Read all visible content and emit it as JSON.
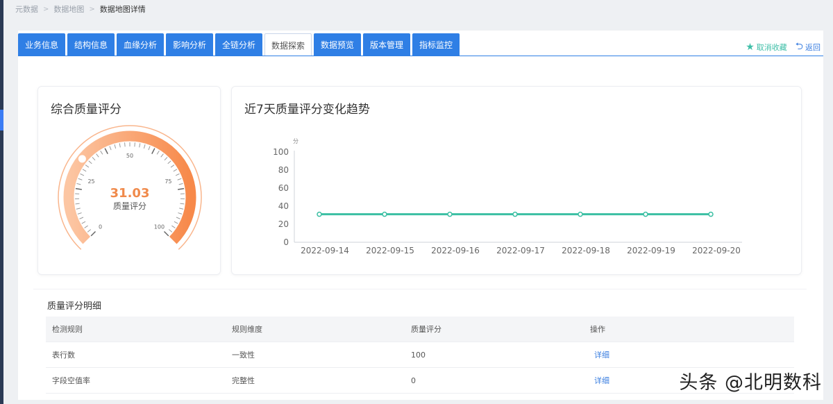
{
  "breadcrumb": [
    "元数据",
    "数据地图",
    "数据地图详情"
  ],
  "tabs": [
    {
      "label": "业务信息",
      "active": false
    },
    {
      "label": "结构信息",
      "active": false
    },
    {
      "label": "血缘分析",
      "active": false
    },
    {
      "label": "影响分析",
      "active": false
    },
    {
      "label": "全链分析",
      "active": false
    },
    {
      "label": "数据探索",
      "active": true
    },
    {
      "label": "数据预览",
      "active": false
    },
    {
      "label": "版本管理",
      "active": false
    },
    {
      "label": "指标监控",
      "active": false
    }
  ],
  "actions": {
    "favorite": "取消收藏",
    "back": "返回",
    "favorite_icon": "star-icon",
    "back_icon": "return-arrow-icon"
  },
  "score": {
    "title": "综合质量评分",
    "value": 31.03,
    "value_text": "31.03",
    "label": "质量评分",
    "ticks": [
      "0",
      "25",
      "50",
      "75",
      "100"
    ],
    "max": 100,
    "color": "#f7935a"
  },
  "trend": {
    "title": "近7天质量评分变化趋势",
    "unit": "分",
    "line_color": "#3bbfa3"
  },
  "chart_data": {
    "type": "line",
    "title": "近7天质量评分变化趋势",
    "ylabel": "分",
    "xlabel": "",
    "x": [
      "2022-09-14",
      "2022-09-15",
      "2022-09-16",
      "2022-09-17",
      "2022-09-18",
      "2022-09-19",
      "2022-09-20"
    ],
    "series": [
      {
        "values": [
          31.03,
          31.03,
          31.03,
          31.03,
          31.03,
          31.03,
          31.03
        ]
      }
    ],
    "yticks": [
      0,
      20,
      40,
      60,
      80,
      100
    ],
    "ylim": [
      0,
      100
    ],
    "grid": false
  },
  "detail": {
    "title": "质量评分明细",
    "columns": [
      "检测规则",
      "规则维度",
      "质量评分",
      "操作"
    ],
    "rows": [
      {
        "rule": "表行数",
        "dimension": "一致性",
        "score": "100",
        "action": "详细"
      },
      {
        "rule": "字段空值率",
        "dimension": "完整性",
        "score": "0",
        "action": "详细"
      }
    ]
  },
  "watermark": "头条 @北明数科"
}
